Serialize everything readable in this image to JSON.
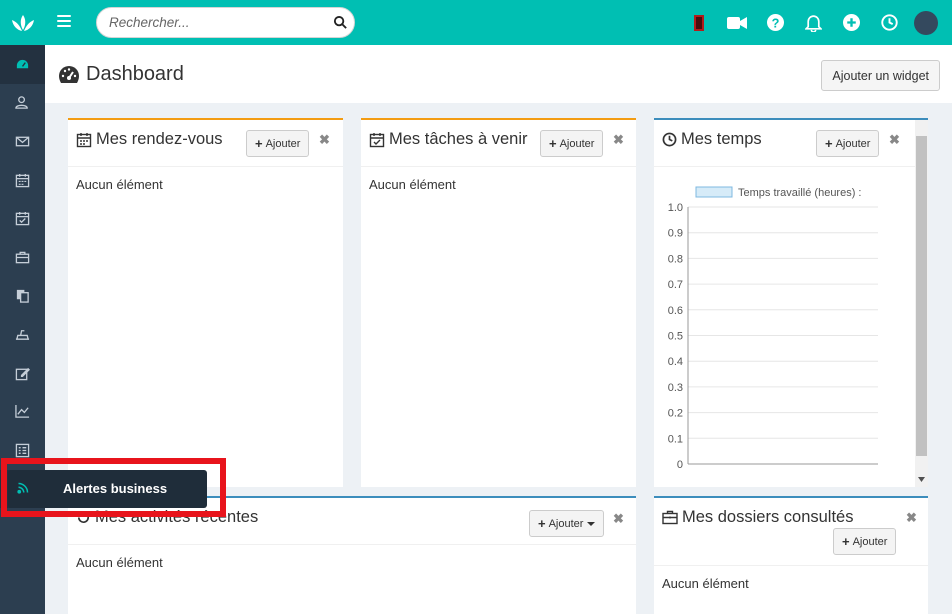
{
  "topbar": {
    "search_placeholder": "Rechercher..."
  },
  "sidebar": {
    "items": [
      {
        "icon": "dashboard-icon",
        "active": true
      },
      {
        "icon": "contacts-icon"
      },
      {
        "icon": "mail-icon"
      },
      {
        "icon": "calendar-icon"
      },
      {
        "icon": "tasks-icon"
      },
      {
        "icon": "briefcase-icon"
      },
      {
        "icon": "documents-icon"
      },
      {
        "icon": "billing-icon"
      },
      {
        "icon": "edit-icon"
      },
      {
        "icon": "stats-icon"
      },
      {
        "icon": "list-icon"
      },
      {
        "icon": "rss-icon",
        "tooltip": "Alertes business"
      }
    ]
  },
  "header": {
    "title": "Dashboard",
    "add_widget_label": "Ajouter un widget"
  },
  "widgets": {
    "rendezvous": {
      "title": "Mes rendez-vous",
      "add_label": "Ajouter",
      "empty_text": "Aucun élément"
    },
    "taches": {
      "title": "Mes tâches à venir",
      "add_label": "Ajouter",
      "empty_text": "Aucun élément"
    },
    "temps": {
      "title": "Mes temps",
      "add_label": "Ajouter"
    },
    "activites": {
      "title": "Mes activités récentes",
      "add_label": "Ajouter",
      "empty_text": "Aucun élément"
    },
    "dossiers": {
      "title": "Mes dossiers consultés",
      "add_label": "Ajouter",
      "empty_text": "Aucun élément"
    }
  },
  "tooltip": {
    "label": "Alertes business"
  },
  "colors": {
    "accent": "#00bfb3",
    "sidebar": "#2c3e50",
    "orange": "#f39c12",
    "blue": "#3c8dbc",
    "highlight": "#e8141c"
  },
  "chart_data": {
    "type": "bar",
    "series": [
      {
        "name": "Temps travaillé (heures) :",
        "values": []
      }
    ],
    "ylim": [
      0,
      1.0
    ],
    "yticks": [
      "1.0",
      "0.9",
      "0.8",
      "0.7",
      "0.6",
      "0.5",
      "0.4",
      "0.3",
      "0.2",
      "0.1",
      "0"
    ],
    "grid": true,
    "legend": "top"
  }
}
